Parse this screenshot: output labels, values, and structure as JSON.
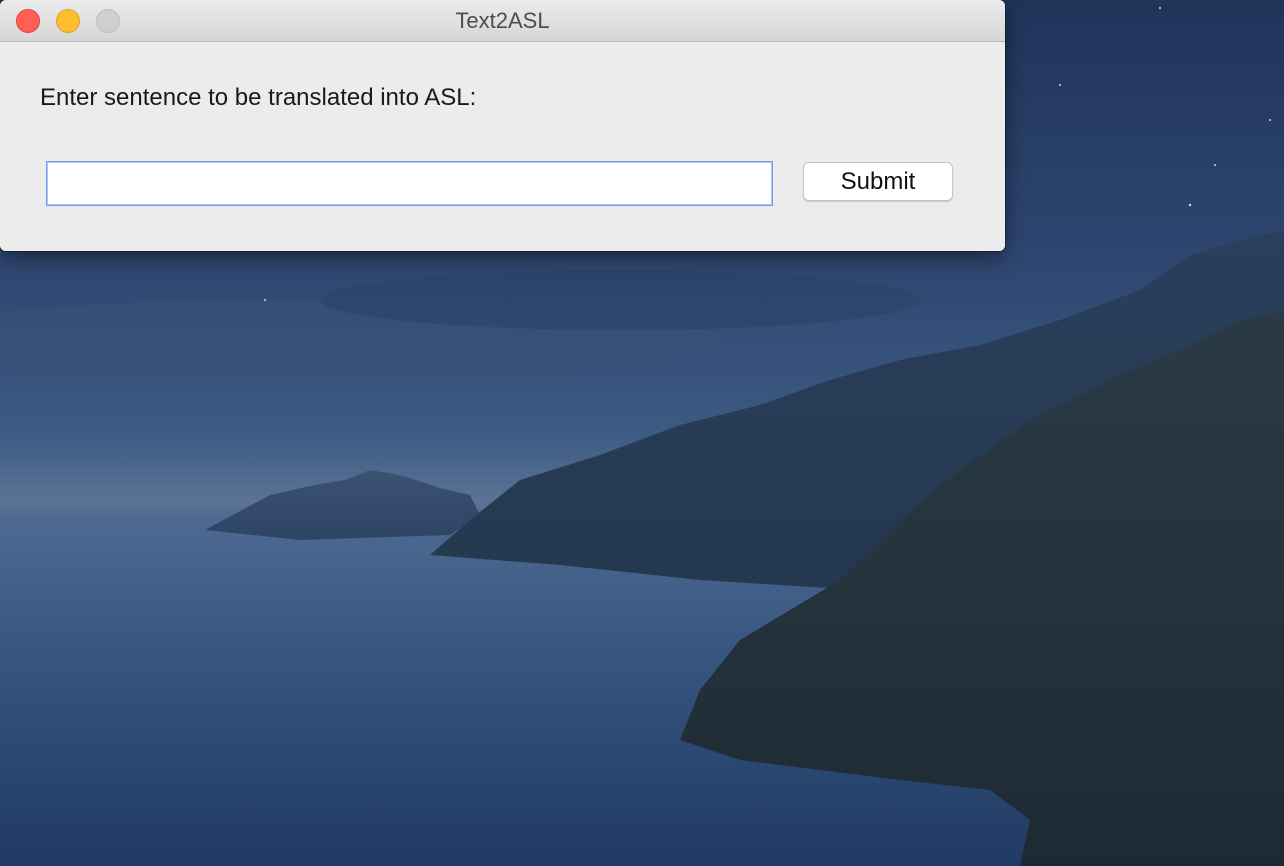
{
  "window": {
    "title": "Text2ASL"
  },
  "form": {
    "prompt_label": "Enter sentence to be translated into ASL:",
    "input_value": "",
    "submit_label": "Submit"
  },
  "colors": {
    "close": "#fe5f57",
    "minimize": "#febc2e",
    "maximize": "#cfcfcf",
    "input_focus_border": "#6aa1e8"
  },
  "icons": [
    "close-icon",
    "minimize-icon",
    "zoom-icon"
  ]
}
